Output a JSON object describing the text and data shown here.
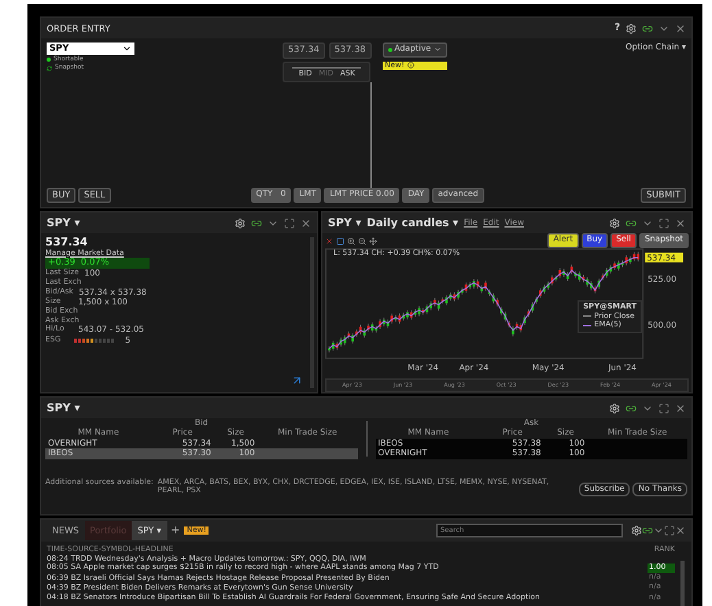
{
  "order_entry": {
    "title": "ORDER ENTRY",
    "help": "?",
    "symbol": "SPY",
    "flags": [
      {
        "kind": "dot",
        "label": "Shortable"
      },
      {
        "kind": "refresh",
        "label": "Snapshot"
      }
    ],
    "prices": [
      "537.34",
      "537.38"
    ],
    "slider_labels": [
      {
        "label": "BID",
        "disabled": false
      },
      {
        "label": "MID",
        "disabled": true
      },
      {
        "label": "ASK",
        "disabled": false
      }
    ],
    "algo": "Adaptive",
    "new_badge": "New!",
    "option_chain": "Option Chain",
    "option_chain_caret": "▾",
    "buy": "BUY",
    "sell": "SELL",
    "qty_label": "QTY",
    "qty": "0",
    "order_type": "LMT",
    "lmt_label": "LMT PRICE",
    "lmt_price": "0.00",
    "tif": "DAY",
    "advanced": "advanced",
    "submit": "SUBMIT"
  },
  "quote": {
    "symbol": "SPY",
    "symbol_caret": "▾",
    "last": "537.34",
    "manage": "Manage Market Data",
    "change": "+0.39",
    "change_pct": "0.07%",
    "fields": [
      {
        "label": "Last Size",
        "value": "100"
      },
      {
        "label": "Last Exch"
      },
      {
        "label": "Bid/Ask",
        "value": "537.34 x 537.38"
      },
      {
        "label": "Size",
        "value": "1,500 x 100"
      },
      {
        "label": "Bid Exch"
      },
      {
        "label": "Ask Exch"
      },
      {
        "label": "Hi/Lo",
        "value": "543.07 - 532.05"
      }
    ],
    "esg": {
      "label": "ESG",
      "level": 0.5,
      "score": "5"
    }
  },
  "chart": {
    "symbol": "SPY",
    "symbol_caret": "▾",
    "type": "Daily candles",
    "type_caret": "▾",
    "menus": [
      "File",
      "Edit",
      "View"
    ],
    "buttons": [
      {
        "label": "Alert",
        "color": "#d8d820"
      },
      {
        "label": "Buy",
        "color": "#2f3fd8"
      },
      {
        "label": "Sell",
        "color": "#d82a2a"
      },
      {
        "label": "Snapshot",
        "color": "#555555"
      }
    ],
    "info": "L: 537.34 CH: +0.39 CH%: 0.07%",
    "price_tag": "537.34",
    "legend": [
      {
        "kind": "title",
        "label": "SPY@SMART"
      },
      {
        "kind": "dashed",
        "label": "Prior Close"
      },
      {
        "kind": "series"
      }
    ],
    "navigator": [
      "Apr '23",
      "Jun '23",
      "Aug '23",
      "Oct '23",
      "Dec '23",
      "Feb '24",
      "Apr '24"
    ],
    "chart_data": {
      "type": "line",
      "ylim": [
        482,
        542
      ],
      "categories": [
        null,
        null,
        null,
        null,
        null,
        null,
        null,
        null,
        null,
        null,
        null,
        null,
        null,
        null,
        null,
        null,
        null,
        null,
        null,
        null,
        null,
        null,
        null,
        null,
        "Mar '24",
        null,
        null,
        null,
        null,
        null,
        null,
        null,
        null,
        null,
        null,
        null,
        null,
        "Apr '24",
        null,
        null,
        null,
        null,
        null,
        null,
        null,
        null,
        null,
        null,
        null,
        null,
        null,
        null,
        null,
        null,
        null,
        null,
        "May '24",
        null,
        null,
        null,
        null,
        null,
        null,
        null,
        null,
        null,
        null,
        null,
        null,
        null,
        null,
        null,
        null,
        null,
        null,
        "Jun '24",
        null,
        null,
        null,
        null
      ],
      "yticks": [
        {
          "value": 525,
          "label": "525.00"
        },
        {
          "value": 500,
          "label": "500.00"
        }
      ],
      "series": [
        {
          "name": "EMA(5)",
          "color": "#a070e0",
          "marker": true,
          "values": [
            487,
            489,
            488,
            491,
            492,
            494,
            493,
            495,
            497,
            496,
            498,
            499,
            498,
            500,
            502,
            501,
            503,
            504,
            503,
            505,
            506,
            505,
            507,
            508,
            507,
            509,
            511,
            512,
            511,
            513,
            514,
            516,
            515,
            517,
            519,
            520,
            522,
            523,
            522,
            520,
            521,
            518,
            515,
            512,
            508,
            505,
            500,
            497,
            499,
            498,
            503,
            506,
            510,
            514,
            517,
            520,
            522,
            524,
            526,
            528,
            529,
            527,
            530,
            528,
            527,
            525,
            524,
            522,
            519,
            523,
            526,
            529,
            531,
            532,
            533,
            534,
            535,
            536,
            537,
            537
          ]
        }
      ]
    }
  },
  "book": {
    "symbol": "SPY",
    "symbol_caret": "▾",
    "sides": [
      {
        "title": "Bid",
        "columns": [
          "MM Name",
          "Price",
          "Size",
          "Min Trade Size"
        ],
        "rows": [
          {
            "cells": [
              "OVERNIGHT",
              "537.34",
              "1,500"
            ],
            "selected": false
          },
          {
            "cells": [
              "IBEOS",
              "537.30",
              "100"
            ],
            "selected": true
          }
        ]
      },
      {
        "title": "Ask",
        "columns": [
          "MM Name",
          "Price",
          "Size",
          "Min Trade Size"
        ],
        "rows": [
          {
            "cells": [
              "IBEOS",
              "537.38",
              "100"
            ],
            "selected": false
          },
          {
            "cells": [
              "OVERNIGHT",
              "537.38",
              "100"
            ],
            "selected": false
          }
        ]
      }
    ],
    "sources_label": "Additional sources available:",
    "sources": "AMEX, ARCA, BATS, BEX, BYX, CHX, DRCTEDGE, EDGEA, IEX, ISE, ISLAND, LTSE, MEMX, NYSE, NYSENAT, PEARL, PSX",
    "buttons": [
      "Subscribe",
      "No Thanks"
    ]
  },
  "news": {
    "tabs": [
      {
        "label": "NEWS",
        "selected": false
      },
      {
        "label": "Portfolio",
        "selected": false
      },
      {
        "label": "SPY",
        "caret": "▾",
        "selected": true
      }
    ],
    "add": "+",
    "new_badge": "New!",
    "search_placeholder": "Search",
    "header": "TIME-SOURCE-SYMBOL-HEADLINE",
    "rank_header": "RANK",
    "rows": [
      {
        "text": "08:24 TRDD Wednesday's Analysis + Macro Updates tomorrow.: SPY, QQQ, DIA, IWM"
      },
      {
        "text": "08:05 SA Apple market cap surges $215B in rally to record high - where AAPL stands among Mag 7 YTD",
        "rank": {
          "text": "1.00",
          "highlight": true
        }
      },
      {
        "text": "06:39 BZ Israeli Official Says Hamas Rejects Hostage Release Proposal Presented By Biden",
        "rank": {
          "text": "n/a",
          "highlight": false
        }
      },
      {
        "text": "04:39 BZ President Biden Delivers Remarks at Everytown's Gun Sense University",
        "rank": {
          "text": "n/a",
          "highlight": false
        }
      },
      {
        "text": "04:18 BZ Senators Introduce Bipartisan Bill To Establish AI Guardrails For Federal Government, Ensuring Safe And Secure Adoption",
        "rank": {
          "text": "n/a",
          "highlight": false
        }
      }
    ]
  }
}
